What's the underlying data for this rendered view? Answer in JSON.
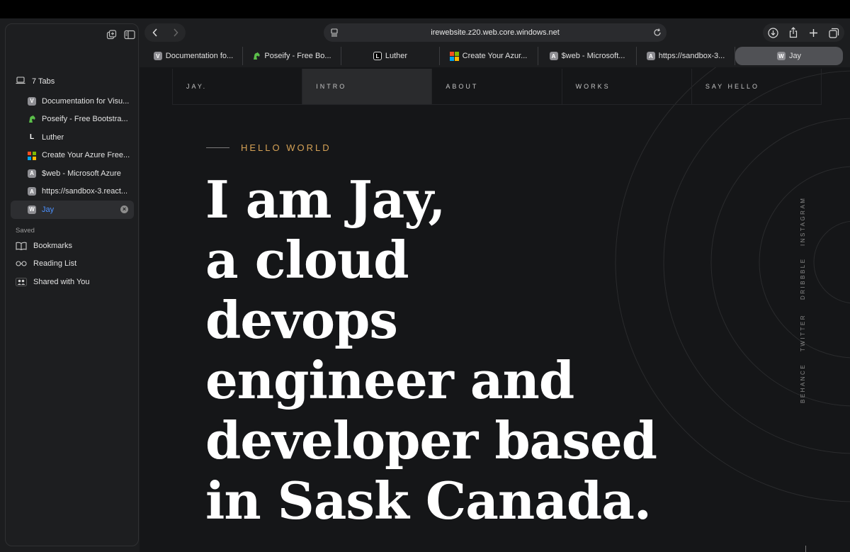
{
  "browser": {
    "url": "irewebsite.z20.web.core.windows.net",
    "tabs": [
      {
        "label": "Documentation fo...",
        "favicon": "V",
        "icon_type": "letter"
      },
      {
        "label": "Poseify - Free Bo...",
        "favicon": "",
        "icon_type": "poseify"
      },
      {
        "label": "Luther",
        "favicon": "L",
        "icon_type": "letter-boxed"
      },
      {
        "label": "Create Your Azur...",
        "favicon": "",
        "icon_type": "microsoft"
      },
      {
        "label": "$web - Microsoft...",
        "favicon": "A",
        "icon_type": "letter"
      },
      {
        "label": "https://sandbox-3...",
        "favicon": "A",
        "icon_type": "letter"
      },
      {
        "label": "Jay",
        "favicon": "W",
        "icon_type": "letter",
        "active": true
      }
    ]
  },
  "sidebar": {
    "group_label": "7 Tabs",
    "items": [
      {
        "label": "Documentation for Visu...",
        "favicon": "V"
      },
      {
        "label": "Poseify - Free Bootstra...",
        "favicon": ""
      },
      {
        "label": "Luther",
        "favicon": "L"
      },
      {
        "label": "Create Your Azure Free...",
        "favicon": ""
      },
      {
        "label": "$web - Microsoft Azure",
        "favicon": "A"
      },
      {
        "label": "https://sandbox-3.react...",
        "favicon": "A"
      },
      {
        "label": "Jay",
        "favicon": "W",
        "active": true
      }
    ],
    "saved_header": "Saved",
    "saved": [
      {
        "label": "Bookmarks",
        "icon": "book-icon"
      },
      {
        "label": "Reading List",
        "icon": "glasses-icon"
      },
      {
        "label": "Shared with You",
        "icon": "people-icon"
      }
    ]
  },
  "site": {
    "nav": [
      "JAY.",
      "INTRO",
      "ABOUT",
      "WORKS",
      "SAY HELLO"
    ],
    "active_nav": "INTRO",
    "kicker": "HELLO WORLD",
    "headline": [
      "I am Jay,",
      "a cloud",
      "devops",
      "engineer and",
      "developer based",
      "in Sask Canada."
    ],
    "social": [
      "INSTAGRAM",
      "DRIBBBLE",
      "TWITTER",
      "BEHANCE"
    ]
  },
  "colors": {
    "accent": "#d6a256",
    "active_tab_text": "#4a90ff",
    "background": "#151618"
  }
}
